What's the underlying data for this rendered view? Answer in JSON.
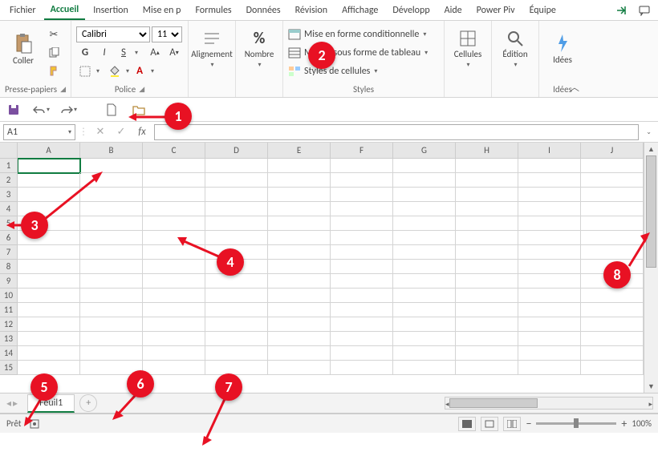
{
  "tabs": [
    "Fichier",
    "Accueil",
    "Insertion",
    "Mise en p",
    "Formules",
    "Données",
    "Révision",
    "Affichage",
    "Développ",
    "Aide",
    "Power Piv",
    "Équipe"
  ],
  "active_tab": 1,
  "ribbon": {
    "clipboard": {
      "paste": "Coller",
      "label": "Presse-papiers"
    },
    "font": {
      "name": "Calibri",
      "size": "11",
      "bold": "G",
      "italic": "I",
      "underline": "S",
      "label": "Police"
    },
    "align": {
      "label": "Alignement",
      "btn": "Alignement"
    },
    "number": {
      "label": "Nombre",
      "btn": "Nombre"
    },
    "styles": {
      "cond": "Mise en forme conditionnelle",
      "table": "Mettre sous forme de tableau",
      "cell": "Styles de cellules",
      "label": "Styles"
    },
    "cells": {
      "label": "Cellules",
      "btn": "Cellules"
    },
    "editing": {
      "label": "Édition",
      "btn": "Édition"
    },
    "ideas": {
      "label": "Idées",
      "btn": "Idées"
    }
  },
  "namebox": "A1",
  "cols": [
    "A",
    "B",
    "C",
    "D",
    "E",
    "F",
    "G",
    "H",
    "I",
    "J"
  ],
  "rows": [
    "1",
    "2",
    "3",
    "4",
    "5",
    "6",
    "7",
    "8",
    "9",
    "10",
    "11",
    "12",
    "13",
    "14",
    "15"
  ],
  "sheet": "Feuil1",
  "status": "Prêt",
  "zoom": "100%",
  "markers": [
    "1",
    "2",
    "3",
    "4",
    "5",
    "6",
    "7",
    "8"
  ]
}
